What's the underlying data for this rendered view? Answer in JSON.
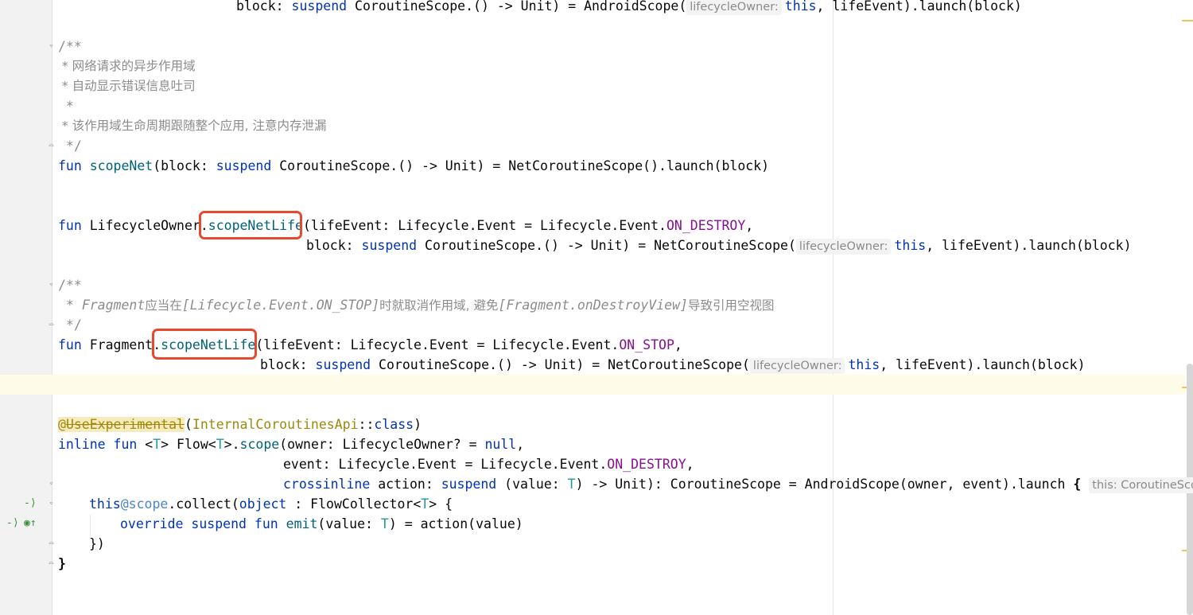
{
  "code": {
    "l1": {
      "pre": "block: ",
      "kw1": "suspend",
      "mid": " CoroutineScope.() -> Unit) = AndroidScope(",
      "hint": "lifecycleOwner:",
      "kw2": "this",
      "post": ", lifeEvent).launch(block)"
    },
    "c1_open": "/**",
    "c1_line1": " * 网络请求的异步作用域",
    "c1_line2": " * 自动显示错误信息吐司",
    "c1_line3": " *",
    "c1_line4": " * 该作用域生命周期跟随整个应用, 注意内存泄漏",
    "c1_close": " */",
    "l_scopeNet": {
      "kw": "fun",
      "name": "scopeNet",
      "a": "(block: ",
      "kw2": "suspend",
      "b": " CoroutineScope.() -> Unit) = NetCoroutineScope().launch(block)"
    },
    "l_owner1": {
      "kw": "fun",
      "a": " LifecycleOwner.",
      "name": "scopeNetLife",
      "b": "(lifeEvent: Lifecycle.Event = Lifecycle.Event.",
      "const": "ON_DESTROY",
      "c": ","
    },
    "l_owner2": {
      "a": "block: ",
      "kw": "suspend",
      "b": " CoroutineScope.() -> Unit) = NetCoroutineScope(",
      "hint": "lifecycleOwner:",
      "kw2": "this",
      "c": ", lifeEvent).launch(block)"
    },
    "c2_open": "/**",
    "c2_line1": {
      "star": " * ",
      "a": "Fragment",
      "b": "应当在",
      "c": "[Lifecycle.Event.ON_STOP]",
      "d": "时就取消作用域, 避免",
      "e": "[Fragment.onDestroyView]",
      "f": "导致引用空视图"
    },
    "c2_close": " */",
    "l_frag1": {
      "kw": "fun",
      "a": " Fragment.",
      "name": "scopeNetLife",
      "b": "(lifeEvent: Lifecycle.Event = Lifecycle.Event.",
      "const": "ON_STOP",
      "c": ","
    },
    "l_frag2": {
      "a": "block: ",
      "kw": "suspend",
      "b": " CoroutineScope.() -> Unit) = NetCoroutineScope(",
      "hint": "lifecycleOwner:",
      "kw2": "this",
      "c": ", lifeEvent).launch(block)"
    },
    "l_annot": {
      "at": "@",
      "name": "UseExperimental",
      "a": "(",
      "cls": "InternalCoroutinesApi",
      "b": "::",
      "kw": "class",
      "c": ")"
    },
    "l_flow1": {
      "kw1": "inline",
      "kw2": "fun",
      "a": " <",
      "t1": "T",
      "b": "> Flow<",
      "t2": "T",
      "c": ">.",
      "name": "scope",
      "d": "(owner: LifecycleOwner? = ",
      "kw3": "null",
      "e": ","
    },
    "l_flow2": {
      "a": "event: Lifecycle.Event = Lifecycle.Event.",
      "const": "ON_DESTROY",
      "b": ","
    },
    "l_flow3": {
      "kw1": "crossinline",
      "a": " action: ",
      "kw2": "suspend",
      "b": " (value: ",
      "t": "T",
      "c": ") -> Unit): CoroutineScope = AndroidScope(owner, event).launch ",
      "brace": "{",
      "hint": "this: CoroutineScop"
    },
    "l_collect": {
      "kw": "this",
      "label": "@scope",
      "a": ".collect(",
      "kw2": "object",
      "b": " : FlowCollector<",
      "t": "T",
      "c": "> {"
    },
    "l_emit": {
      "kw1": "override",
      "kw2": "suspend",
      "kw3": "fun",
      "name": "emit",
      "a": "(value: ",
      "t": "T",
      "b": ") = action(value)"
    },
    "l_close1": "})",
    "l_close2": "}"
  }
}
